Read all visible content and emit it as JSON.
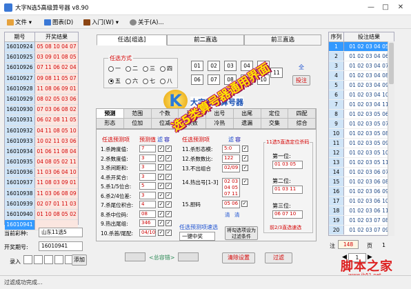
{
  "window": {
    "title": "大字N选5高级算号器 v8.90",
    "minimize": "—",
    "maximize": "□",
    "close": "✕"
  },
  "menu": [
    {
      "label": "文件 ▾",
      "icon": "folder-icon",
      "color": "#e6a23c"
    },
    {
      "label": "图表(D)",
      "icon": "chart-icon",
      "color": "#3a78d6"
    },
    {
      "label": "入门(W) ▾",
      "icon": "book-icon",
      "color": "#8b4513"
    },
    {
      "label": "关于(A)...",
      "icon": "gear-icon",
      "color": "#888888"
    }
  ],
  "left_table": {
    "headers": [
      "期号",
      "开奖结果"
    ],
    "rows": [
      [
        "16010924",
        "05 08 10 04 07"
      ],
      [
        "16010925",
        "03 09 01 08 05"
      ],
      [
        "16010926",
        "07 11 06 02 04"
      ],
      [
        "16010927",
        "09 08 11 05 07"
      ],
      [
        "16010928",
        "11 08 06 09 01"
      ],
      [
        "16010929",
        "08 02 05 03 06"
      ],
      [
        "16010930",
        "07 03 06 08 02"
      ],
      [
        "16010931",
        "06 02 08 11 05"
      ],
      [
        "16010932",
        "04 11 08 05 10"
      ],
      [
        "16010933",
        "10 02 11 03 06"
      ],
      [
        "16010934",
        "01 06 11 08 04"
      ],
      [
        "16010935",
        "04 08 05 02 11"
      ],
      [
        "16010936",
        "11 03 06 04 10"
      ],
      [
        "16010937",
        "11 08 03 09 01"
      ],
      [
        "16010938",
        "11 03 06 08 09"
      ],
      [
        "16010939",
        "02 07 01 11 03"
      ],
      [
        "16010940",
        "01 10 08 05 02"
      ],
      [
        "16010941",
        ""
      ]
    ]
  },
  "lottery": {
    "label": "当前彩种:",
    "value": "山东11选5"
  },
  "issue": {
    "label": "开奖期号:",
    "value": "16010941"
  },
  "entry": {
    "label": "录入",
    "add": "添加"
  },
  "top_tabs": [
    "任选[组选]",
    "前二直选",
    "前三直选"
  ],
  "renxuan": {
    "legend": "任选方式",
    "options": [
      "一",
      "二",
      "三",
      "四",
      "五",
      "六",
      "七",
      "八"
    ],
    "selected": "五"
  },
  "numbers": [
    "01",
    "02",
    "03",
    "04",
    "05",
    "06",
    "07",
    "08",
    "09",
    "10",
    "11"
  ],
  "quanxuan": "全",
  "touzhu": "投注",
  "sub_tabs_row1": [
    "预测",
    "范围",
    "个数",
    "形态",
    "出号",
    "出尾",
    "定位",
    "四配"
  ],
  "sub_tabs_row2": [
    "形态",
    "位加",
    "位减",
    "余数",
    "冷热",
    "遗漏",
    "交集",
    "综合"
  ],
  "predict": {
    "header_a": "任选预测项",
    "header_b": "预测值",
    "header_c": "滤",
    "header_d": "容",
    "rows": [
      {
        "label": "1.杀跨度值:",
        "value": "7"
      },
      {
        "label": "2.杀数度值:",
        "value": "3"
      },
      {
        "label": "3.杀间距和:",
        "value": "3"
      },
      {
        "label": "4.杀开奖合:",
        "value": "3"
      },
      {
        "label": "5.杀1/5位合:",
        "value": "5"
      },
      {
        "label": "6.杀2/4位差:",
        "value": "3"
      },
      {
        "label": "7.杀尾位积合:",
        "value": "4"
      },
      {
        "label": "8.杀中位码:",
        "value": "08"
      },
      {
        "label": "9.热出尾组:",
        "value": "346"
      },
      {
        "label": "10.杀首/尾配:",
        "value": "04/10"
      }
    ],
    "rows2": [
      {
        "label": "11.杀形态模:",
        "value": "5:0"
      },
      {
        "label": "12.杀数数比:",
        "value": "122"
      },
      {
        "label": "13.不出组合",
        "value": "02/09"
      },
      {
        "label": "14.热出号[1-3]",
        "value": "02 03 04 05 07 11"
      },
      {
        "label": "15.胆码",
        "value": "05 06"
      }
    ],
    "qing": "清",
    "qing2": "清"
  },
  "pos_box": {
    "title": "11选5直选定位杀码",
    "pos1": "第一位:",
    "pos1v": "01 03 05",
    "pos2": "第二位:",
    "pos2v": "01 03 11",
    "pos3": "第三位:",
    "pos3v": "06 07 10",
    "footer": "前2/3直选速选"
  },
  "quick_filter": {
    "label": "任选预测项速选",
    "select": "一键中奖",
    "convert": "将勾选项设为过滤条件"
  },
  "bottom_bar": {
    "total": "<总容错>",
    "clear": "清除设置",
    "filter": "过滤"
  },
  "right_table": {
    "headers": [
      "序列",
      "投注结果"
    ],
    "rows": [
      [
        "1",
        "01 02 03 04 05"
      ],
      [
        "2",
        "01 02 03 04 06"
      ],
      [
        "3",
        "01 02 03 04 07"
      ],
      [
        "4",
        "01 02 03 04 08"
      ],
      [
        "5",
        "01 02 03 04 09"
      ],
      [
        "6",
        "01 02 03 04 10"
      ],
      [
        "7",
        "01 02 03 04 11"
      ],
      [
        "8",
        "01 02 03 05 06"
      ],
      [
        "9",
        "01 02 03 05 07"
      ],
      [
        "10",
        "01 02 03 05 08"
      ],
      [
        "11",
        "01 02 03 05 09"
      ],
      [
        "12",
        "01 02 03 05 10"
      ],
      [
        "13",
        "01 02 03 05 11"
      ],
      [
        "14",
        "01 02 03 06 07"
      ],
      [
        "15",
        "01 02 03 06 08"
      ],
      [
        "16",
        "01 02 03 06 09"
      ],
      [
        "17",
        "01 02 03 06 10"
      ],
      [
        "18",
        "01 02 03 06 11"
      ],
      [
        "19",
        "01 02 03 07 08"
      ],
      [
        "20",
        "01 02 03 07 09"
      ]
    ],
    "count_label": "注",
    "count": "148",
    "page_label": "页",
    "page": "1",
    "nav_value": "1"
  },
  "brand": {
    "logo_letter": "K",
    "name": "大字彩票算号器"
  },
  "banner": "选5类算号器通用界面",
  "watermark": {
    "cn": "脚本之家",
    "url": "www.jb51.net"
  },
  "status": "过滤成功完成..."
}
